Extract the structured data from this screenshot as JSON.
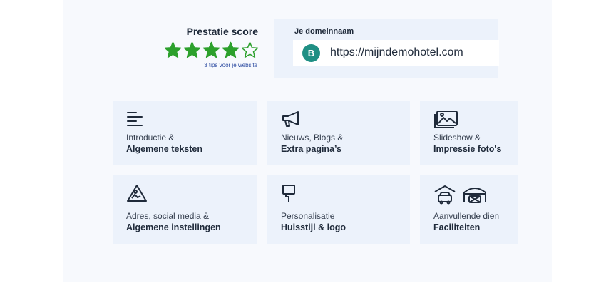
{
  "score": {
    "title": "Prestatie score",
    "rating": 4,
    "max_rating": 5,
    "star_color": "#2ca02c",
    "tips_link": "3 tips voor je website"
  },
  "domain": {
    "label": "Je domeinnaam",
    "badge": "B",
    "badge_color": "#1f8f84",
    "url": "https://mijndemohotel.com"
  },
  "tiles": [
    {
      "icon": "text-lines-icon",
      "line1": "Introductie &",
      "line2": "Algemene teksten"
    },
    {
      "icon": "megaphone-icon",
      "line1": "Nieuws, Blogs &",
      "line2": "Extra pagina’s"
    },
    {
      "icon": "photos-icon",
      "line1": "Slideshow &",
      "line2": "Impressie foto’s"
    },
    {
      "icon": "map-warning-icon",
      "line1": "Adres, social media &",
      "line2": "Algemene instellingen"
    },
    {
      "icon": "paint-roller-icon",
      "line1": "Personalisatie",
      "line2": "Huisstijl & logo"
    },
    {
      "icon": "parking-garage-icon",
      "line1": "Aanvullende dien",
      "line2": "Faciliteiten"
    }
  ]
}
